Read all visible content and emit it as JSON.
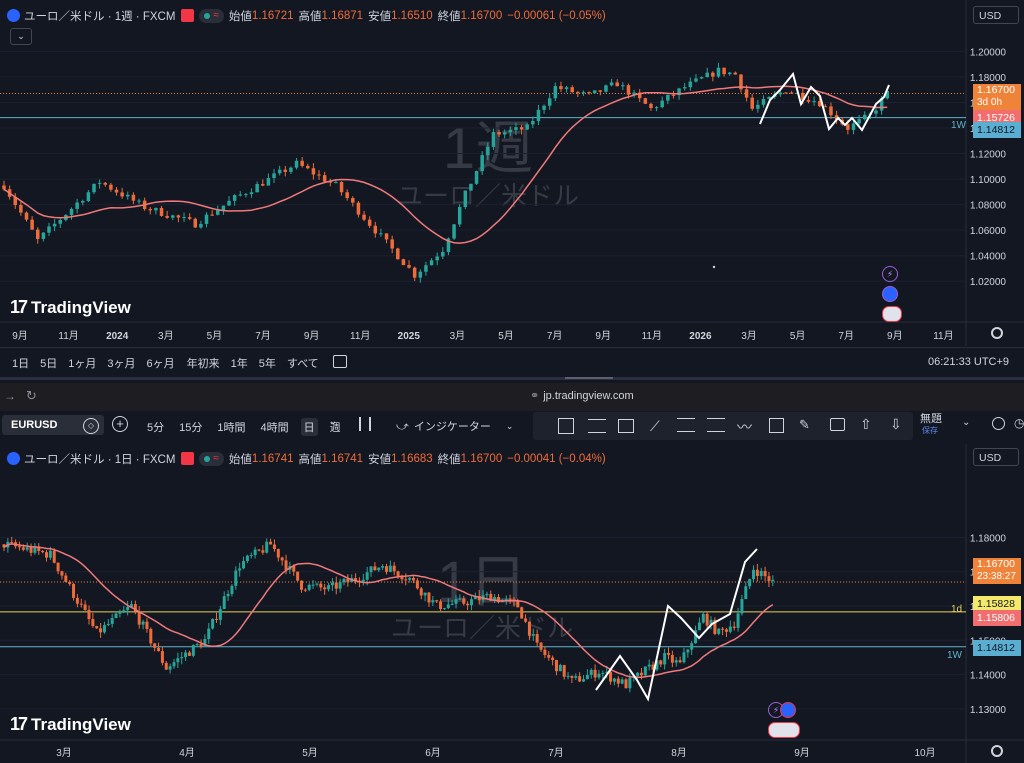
{
  "browser": {
    "url": "jp.tradingview.com"
  },
  "toolbar": {
    "symbol": "EURUSD",
    "intervals": [
      "5分",
      "15分",
      "1時間",
      "4時間",
      "日",
      "週"
    ],
    "active_interval": "日",
    "indicator_label": "インジケーター",
    "layout_name": "無題",
    "save_label": "保存"
  },
  "panel_weekly": {
    "title": "ユーロ／米ドル · 1週 · FXCM",
    "open_label": "始値",
    "open": "1.16721",
    "high_label": "高値",
    "high": "1.16871",
    "low_label": "安値",
    "low": "1.16510",
    "close_label": "終値",
    "close": "1.16700",
    "change": "−0.00061 (−0.05%)",
    "currency": "USD",
    "watermark_interval": "1週",
    "watermark_name": "ユーロ／米ドル",
    "logo": "TradingView",
    "price_ticks": [
      "1.20000",
      "1.18000",
      "1.16000",
      "1.14000",
      "1.12000",
      "1.10000",
      "1.08000",
      "1.06000",
      "1.04000",
      "1.02000"
    ],
    "last_price_label": "1.16700",
    "countdown": "3d 0h",
    "ma_label": "1.15726",
    "level_label": "1.14812",
    "level_tag": "1W",
    "time_ticks": [
      "9月",
      "11月",
      "2024",
      "3月",
      "5月",
      "7月",
      "9月",
      "11月",
      "2025",
      "3月",
      "5月",
      "7月",
      "9月",
      "11月",
      "2026",
      "3月",
      "5月",
      "7月",
      "9月",
      "11月"
    ],
    "range_buttons": [
      "1日",
      "5日",
      "1ヶ月",
      "3ヶ月",
      "6ヶ月",
      "年初来",
      "1年",
      "5年",
      "すべて"
    ],
    "clock": "06:21:33 UTC+9"
  },
  "panel_daily": {
    "title": "ユーロ／米ドル · 1日 · FXCM",
    "open_label": "始値",
    "open": "1.16741",
    "high_label": "高値",
    "high": "1.16741",
    "low_label": "安値",
    "low": "1.16683",
    "close_label": "終値",
    "close": "1.16700",
    "change": "−0.00041 (−0.04%)",
    "currency": "USD",
    "watermark_interval": "1日",
    "watermark_name": "ユーロ／米ドル",
    "logo": "TradingView",
    "price_ticks": [
      "1.18000",
      "1.17000",
      "1.16000",
      "1.15000",
      "1.14000",
      "1.13000"
    ],
    "last_price_label": "1.16700",
    "countdown": "23:38:27",
    "level_1d_label": "1.15828",
    "level_1d_tag": "1d",
    "ma_label": "1.15806",
    "level_label": "1.14812",
    "level_tag": "1W",
    "time_ticks": [
      "3月",
      "4月",
      "5月",
      "6月",
      "7月",
      "8月",
      "9月",
      "10月"
    ]
  },
  "colors": {
    "bg": "#131722",
    "up": "#26a69a",
    "down": "#ef6c3a",
    "ma": "#f07a7a",
    "level_blue": "#5fb3c9",
    "level_yellow": "#e8d35a",
    "last_price": "#f0833a",
    "ma_chip": "#f26d6d",
    "blue_chip": "#5aaed1",
    "yellow_chip": "#f5e96b"
  },
  "chart_data": [
    {
      "type": "candlestick",
      "title": "ユーロ／米ドル · 1週 · FXCM",
      "interval": "1週",
      "ylim": [
        1.01,
        1.205
      ],
      "x_range": [
        "2023-08-21",
        "2026-11-30"
      ],
      "ma_last": 1.15726,
      "last_close": 1.167,
      "horizontal_levels": [
        {
          "label": "1W",
          "value": 1.14812
        }
      ],
      "anchors": [
        [
          "2023-08-21",
          1.095
        ],
        [
          "2023-10-02",
          1.052
        ],
        [
          "2023-12-18",
          1.098
        ],
        [
          "2024-02-12",
          1.078
        ],
        [
          "2024-04-15",
          1.065
        ],
        [
          "2024-06-03",
          1.085
        ],
        [
          "2024-08-19",
          1.112
        ],
        [
          "2024-10-07",
          1.095
        ],
        [
          "2024-12-30",
          1.035
        ],
        [
          "2025-01-13",
          1.025
        ],
        [
          "2025-02-17",
          1.045
        ],
        [
          "2025-03-17",
          1.088
        ],
        [
          "2025-04-21",
          1.135
        ],
        [
          "2025-06-02",
          1.14
        ],
        [
          "2025-07-07",
          1.172
        ],
        [
          "2025-08-18",
          1.165
        ],
        [
          "2025-09-22",
          1.175
        ],
        [
          "2025-11-03",
          1.155
        ],
        [
          "2025-12-15",
          1.172
        ],
        [
          "2026-01-26",
          1.185
        ],
        [
          "2026-02-16",
          1.182
        ],
        [
          "2026-03-09",
          1.155
        ],
        [
          "2026-04-20",
          1.17
        ],
        [
          "2026-06-01",
          1.16
        ],
        [
          "2026-07-06",
          1.14
        ],
        [
          "2026-08-03",
          1.15
        ],
        [
          "2026-08-24",
          1.167
        ]
      ]
    },
    {
      "type": "candlestick",
      "title": "ユーロ／米ドル · 1日 · FXCM",
      "interval": "1日",
      "ylim": [
        1.125,
        1.188
      ],
      "x_range": [
        "2026-02-13",
        "2026-10-20"
      ],
      "last_close": 1.167,
      "ma_last": 1.15806,
      "horizontal_levels": [
        {
          "label": "1d",
          "value": 1.15828
        },
        {
          "label": "1W",
          "value": 1.14812
        }
      ],
      "anchors": [
        [
          "2026-02-13",
          1.178
        ],
        [
          "2026-02-25",
          1.175
        ],
        [
          "2026-03-09",
          1.152
        ],
        [
          "2026-03-18",
          1.16
        ],
        [
          "2026-03-27",
          1.142
        ],
        [
          "2026-04-06",
          1.15
        ],
        [
          "2026-04-15",
          1.172
        ],
        [
          "2026-04-23",
          1.178
        ],
        [
          "2026-05-01",
          1.166
        ],
        [
          "2026-05-08",
          1.165
        ],
        [
          "2026-05-15",
          1.168
        ],
        [
          "2026-05-22",
          1.172
        ],
        [
          "2026-05-29",
          1.168
        ],
        [
          "2026-06-05",
          1.16
        ],
        [
          "2026-06-12",
          1.161
        ],
        [
          "2026-06-19",
          1.163
        ],
        [
          "2026-06-26",
          1.16
        ],
        [
          "2026-07-01",
          1.148
        ],
        [
          "2026-07-10",
          1.138
        ],
        [
          "2026-07-17",
          1.141
        ],
        [
          "2026-07-24",
          1.137
        ],
        [
          "2026-08-03",
          1.145
        ],
        [
          "2026-08-07",
          1.143
        ],
        [
          "2026-08-13",
          1.157
        ],
        [
          "2026-08-17",
          1.152
        ],
        [
          "2026-08-21",
          1.155
        ],
        [
          "2026-08-26",
          1.171
        ],
        [
          "2026-08-31",
          1.167
        ]
      ]
    }
  ]
}
